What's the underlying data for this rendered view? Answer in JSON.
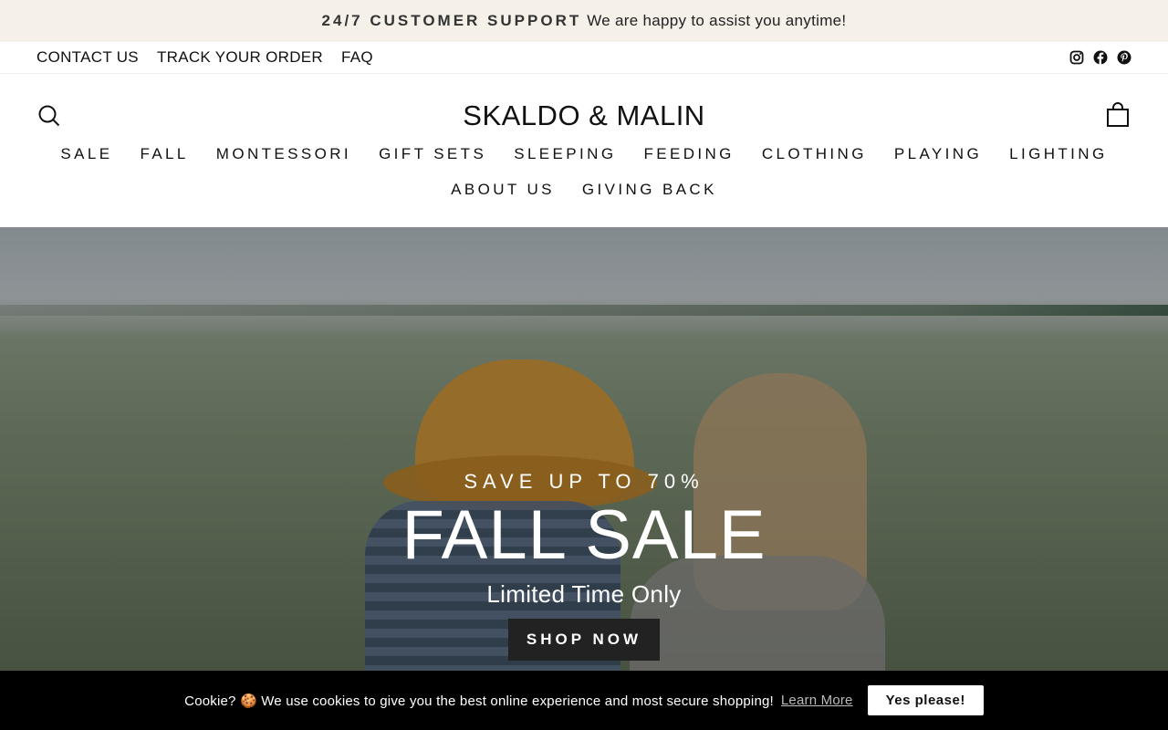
{
  "announcement": {
    "strong": "24/7 CUSTOMER SUPPORT",
    "message": "We are happy to assist you anytime!"
  },
  "utility": {
    "links": [
      "CONTACT US",
      "TRACK YOUR ORDER",
      "FAQ"
    ],
    "social": [
      "instagram-icon",
      "facebook-icon",
      "pinterest-icon"
    ]
  },
  "header": {
    "logo": "SKALDO & MALIN",
    "nav_row1": [
      "SALE",
      "FALL",
      "MONTESSORI",
      "GIFT SETS",
      "SLEEPING",
      "FEEDING",
      "CLOTHING",
      "PLAYING",
      "LIGHTING"
    ],
    "nav_row2": [
      "ABOUT US",
      "GIVING BACK"
    ]
  },
  "hero": {
    "kicker": "SAVE UP TO 70%",
    "headline": "FALL SALE",
    "subheadline": "Limited Time Only",
    "cta": "SHOP NOW"
  },
  "cookie": {
    "message": "Cookie? 🍪 We use cookies to give you the best online experience and most secure shopping!",
    "link": "Learn More",
    "accept": "Yes please!"
  }
}
